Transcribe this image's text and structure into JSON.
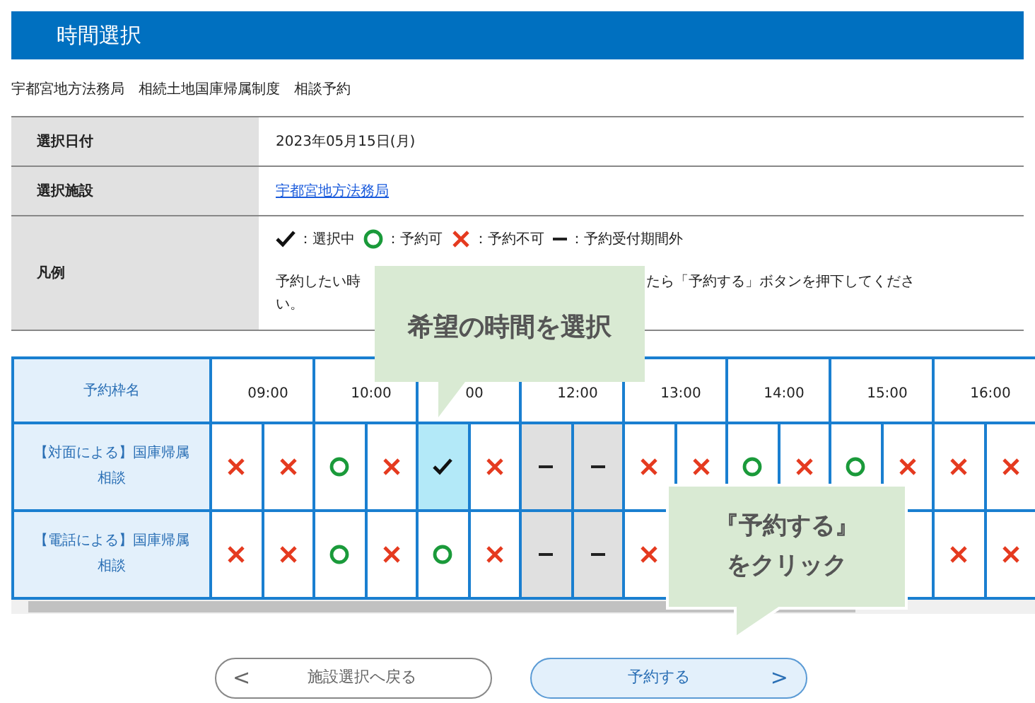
{
  "header": {
    "title": "時間選択"
  },
  "breadcrumb": "宇都宮地方法務局　相続土地国庫帰属制度　相談予約",
  "info": {
    "date": {
      "label": "選択日付",
      "value": "2023年05月15日(月)"
    },
    "facility": {
      "label": "選択施設",
      "value": "宇都宮地方法務局"
    },
    "legend": {
      "label": "凡例",
      "items": [
        {
          "kind": "selected",
          "text": "：選択中"
        },
        {
          "kind": "available",
          "text": "：予約可"
        },
        {
          "kind": "unavailable",
          "text": "：予約不可"
        },
        {
          "kind": "outside",
          "text": "：予約受付期間外"
        }
      ],
      "note_parts": [
        "予約したい時",
        "たら「予約する」ボタンを押下してくださ",
        "い。"
      ]
    }
  },
  "schedule": {
    "corner": "予約枠名",
    "hours": [
      "09:00",
      "10:00",
      "00",
      "12:00",
      "13:00",
      "14:00",
      "15:00",
      "16:00"
    ],
    "rows": [
      {
        "name": "【対面による】国庫帰属相談",
        "slots": [
          {
            "kind": "unavailable"
          },
          {
            "kind": "unavailable"
          },
          {
            "kind": "available"
          },
          {
            "kind": "unavailable"
          },
          {
            "kind": "selected"
          },
          {
            "kind": "unavailable"
          },
          {
            "kind": "outside"
          },
          {
            "kind": "outside"
          },
          {
            "kind": "unavailable"
          },
          {
            "kind": "unavailable"
          },
          {
            "kind": "available"
          },
          {
            "kind": "unavailable"
          },
          {
            "kind": "available"
          },
          {
            "kind": "unavailable"
          },
          {
            "kind": "unavailable"
          },
          {
            "kind": "unavailable"
          }
        ]
      },
      {
        "name": "【電話による】国庫帰属相談",
        "slots": [
          {
            "kind": "unavailable"
          },
          {
            "kind": "unavailable"
          },
          {
            "kind": "available"
          },
          {
            "kind": "unavailable"
          },
          {
            "kind": "available"
          },
          {
            "kind": "unavailable"
          },
          {
            "kind": "outside"
          },
          {
            "kind": "outside"
          },
          {
            "kind": "unavailable"
          },
          {
            "kind": "covered"
          },
          {
            "kind": "covered"
          },
          {
            "kind": "covered"
          },
          {
            "kind": "covered"
          },
          {
            "kind": "covered"
          },
          {
            "kind": "unavailable"
          },
          {
            "kind": "unavailable"
          }
        ]
      }
    ]
  },
  "buttons": {
    "back": {
      "arrow": "<",
      "label": "施設選択へ戻る"
    },
    "reserve": {
      "label": "予約する",
      "arrow": ">"
    }
  },
  "callouts": [
    {
      "kind": "time",
      "lines": [
        "希望の時間を選択"
      ]
    },
    {
      "kind": "reserve",
      "lines": [
        "『予約する』",
        "をクリック"
      ]
    }
  ]
}
